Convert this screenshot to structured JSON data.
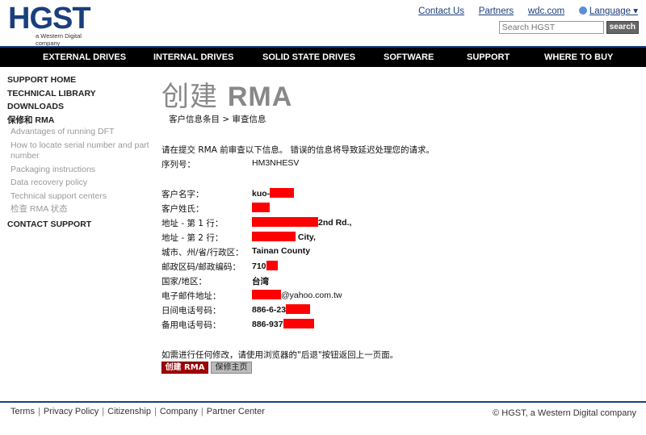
{
  "header": {
    "logo_text": "HGST",
    "logo_sub": "a Western Digital company",
    "links": [
      "Contact Us",
      "Partners",
      "wdc.com"
    ],
    "language": "Language",
    "search_placeholder": "Search HGST",
    "search_button": "search",
    "brand_color": "#1b3f7d"
  },
  "nav": {
    "items": [
      "EXTERNAL DRIVES",
      "INTERNAL DRIVES",
      "SOLID STATE DRIVES",
      "SOFTWARE",
      "SUPPORT",
      "WHERE TO BUY"
    ]
  },
  "sidebar": {
    "items": [
      {
        "label": "SUPPORT HOME"
      },
      {
        "label": "TECHNICAL LIBRARY"
      },
      {
        "label": "DOWNLOADS"
      },
      {
        "label": "保修和 RMA"
      },
      {
        "label": "Advantages of running DFT"
      },
      {
        "label": "How to locate serial number and part number"
      },
      {
        "label": "Packaging instructions"
      },
      {
        "label": "Data recovery policy"
      },
      {
        "label": "Technical support centers"
      },
      {
        "label": "检查 RMA 状态"
      },
      {
        "label": "CONTACT SUPPORT"
      }
    ]
  },
  "main": {
    "title_cn": "创建",
    "title_rma": "RMA",
    "breadcrumb": "客户信息条目 > 审查信息",
    "intro": "请在提交 RMA 前审查以下信息。 错误的信息将导致延迟处理您的请求。",
    "serial": {
      "label": "序列号：",
      "value": "HM3NHESV"
    },
    "fields": [
      {
        "label": "客户名字：",
        "value": "kuo-"
      },
      {
        "label": "客户姓氏：",
        "value": ""
      },
      {
        "label": "地址 - 第 1 行：",
        "value": "2nd Rd.,"
      },
      {
        "label": "地址 - 第 2 行：",
        "value": "City,"
      },
      {
        "label": "城市、州/省/行政区：",
        "value": "Tainan County"
      },
      {
        "label": "邮政区码/邮政编码：",
        "value": "710"
      },
      {
        "label": "国家/地区：",
        "value": "台湾"
      },
      {
        "label": "电子邮件地址：",
        "value": "@yahoo.com.tw"
      },
      {
        "label": "日间电话号码：",
        "value": "886-6-23"
      },
      {
        "label": "备用电话号码：",
        "value": "886-937"
      }
    ],
    "note": "如需进行任何修改，请使用浏览器的\"后退\"按钮返回上一页面。",
    "create_button": "创建 RMA",
    "home_button": "保修主页",
    "redaction_color": "#ff0000"
  },
  "footer": {
    "links": [
      "Terms",
      "Privacy Policy",
      "Citizenship",
      "Company",
      "Partner Center"
    ],
    "copyright": "© HGST, a Western Digital company"
  }
}
